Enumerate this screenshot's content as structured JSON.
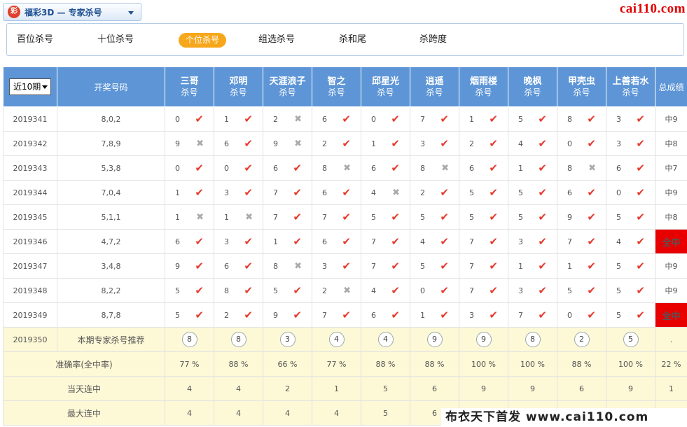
{
  "lottery_select": {
    "logo": "彩",
    "label": "福彩3D — 专家杀号"
  },
  "brand": "cai110.com",
  "tabs": [
    {
      "label": "百位杀号",
      "active": false
    },
    {
      "label": "十位杀号",
      "active": false
    },
    {
      "label": "个位杀号",
      "active": true
    },
    {
      "label": "组选杀号",
      "active": false
    },
    {
      "label": "杀和尾",
      "active": false
    },
    {
      "label": "杀跨度",
      "active": false
    }
  ],
  "table": {
    "period_select": "近10期",
    "draw_header": "开奖号码",
    "total_header": "总成绩",
    "experts": [
      {
        "name": "三哥",
        "sub": "杀号"
      },
      {
        "name": "邓明",
        "sub": "杀号"
      },
      {
        "name": "天涯浪子",
        "sub": "杀号"
      },
      {
        "name": "智之",
        "sub": "杀号"
      },
      {
        "name": "邱星光",
        "sub": "杀号"
      },
      {
        "name": "逍遥",
        "sub": "杀号"
      },
      {
        "name": "烟雨楼",
        "sub": "杀号"
      },
      {
        "name": "晚枫",
        "sub": "杀号"
      },
      {
        "name": "甲壳虫",
        "sub": "杀号"
      },
      {
        "name": "上善若水",
        "sub": "杀号"
      }
    ],
    "rows": [
      {
        "period": "2019341",
        "draw": "8,0,2",
        "kills": [
          [
            "0",
            1
          ],
          [
            "1",
            1
          ],
          [
            "2",
            0
          ],
          [
            "6",
            1
          ],
          [
            "0",
            1
          ],
          [
            "7",
            1
          ],
          [
            "1",
            1
          ],
          [
            "5",
            1
          ],
          [
            "8",
            1
          ],
          [
            "3",
            1
          ]
        ],
        "total": "中9",
        "full": false
      },
      {
        "period": "2019342",
        "draw": "7,8,9",
        "kills": [
          [
            "9",
            0
          ],
          [
            "6",
            1
          ],
          [
            "9",
            0
          ],
          [
            "2",
            1
          ],
          [
            "1",
            1
          ],
          [
            "3",
            1
          ],
          [
            "2",
            1
          ],
          [
            "4",
            1
          ],
          [
            "0",
            1
          ],
          [
            "3",
            1
          ]
        ],
        "total": "中8",
        "full": false
      },
      {
        "period": "2019343",
        "draw": "5,3,8",
        "kills": [
          [
            "0",
            1
          ],
          [
            "0",
            1
          ],
          [
            "6",
            1
          ],
          [
            "8",
            0
          ],
          [
            "6",
            1
          ],
          [
            "8",
            0
          ],
          [
            "6",
            1
          ],
          [
            "1",
            1
          ],
          [
            "8",
            0
          ],
          [
            "6",
            1
          ]
        ],
        "total": "中7",
        "full": false
      },
      {
        "period": "2019344",
        "draw": "7,0,4",
        "kills": [
          [
            "1",
            1
          ],
          [
            "3",
            1
          ],
          [
            "7",
            1
          ],
          [
            "6",
            1
          ],
          [
            "4",
            0
          ],
          [
            "2",
            1
          ],
          [
            "5",
            1
          ],
          [
            "5",
            1
          ],
          [
            "6",
            1
          ],
          [
            "0",
            1
          ]
        ],
        "total": "中9",
        "full": false
      },
      {
        "period": "2019345",
        "draw": "5,1,1",
        "kills": [
          [
            "1",
            0
          ],
          [
            "1",
            0
          ],
          [
            "7",
            1
          ],
          [
            "7",
            1
          ],
          [
            "5",
            1
          ],
          [
            "5",
            1
          ],
          [
            "5",
            1
          ],
          [
            "5",
            1
          ],
          [
            "9",
            1
          ],
          [
            "5",
            1
          ]
        ],
        "total": "中8",
        "full": false
      },
      {
        "period": "2019346",
        "draw": "4,7,2",
        "kills": [
          [
            "6",
            1
          ],
          [
            "3",
            1
          ],
          [
            "1",
            1
          ],
          [
            "6",
            1
          ],
          [
            "7",
            1
          ],
          [
            "4",
            1
          ],
          [
            "7",
            1
          ],
          [
            "3",
            1
          ],
          [
            "7",
            1
          ],
          [
            "4",
            1
          ]
        ],
        "total": "全中",
        "full": true
      },
      {
        "period": "2019347",
        "draw": "3,4,8",
        "kills": [
          [
            "9",
            1
          ],
          [
            "6",
            1
          ],
          [
            "8",
            0
          ],
          [
            "3",
            1
          ],
          [
            "7",
            1
          ],
          [
            "5",
            1
          ],
          [
            "7",
            1
          ],
          [
            "1",
            1
          ],
          [
            "1",
            1
          ],
          [
            "5",
            1
          ]
        ],
        "total": "中9",
        "full": false
      },
      {
        "period": "2019348",
        "draw": "8,2,2",
        "kills": [
          [
            "5",
            1
          ],
          [
            "8",
            1
          ],
          [
            "5",
            1
          ],
          [
            "2",
            0
          ],
          [
            "4",
            1
          ],
          [
            "0",
            1
          ],
          [
            "7",
            1
          ],
          [
            "3",
            1
          ],
          [
            "5",
            1
          ],
          [
            "5",
            1
          ]
        ],
        "total": "中9",
        "full": false
      },
      {
        "period": "2019349",
        "draw": "8,7,8",
        "kills": [
          [
            "5",
            1
          ],
          [
            "2",
            1
          ],
          [
            "9",
            1
          ],
          [
            "7",
            1
          ],
          [
            "6",
            1
          ],
          [
            "1",
            1
          ],
          [
            "3",
            1
          ],
          [
            "7",
            1
          ],
          [
            "0",
            1
          ],
          [
            "5",
            1
          ]
        ],
        "total": "全中",
        "full": true
      }
    ],
    "recommend": {
      "period": "2019350",
      "label": "本期专家杀号推荐",
      "numbers": [
        "8",
        "8",
        "3",
        "4",
        "4",
        "9",
        "9",
        "8",
        "2",
        "5"
      ],
      "total": "."
    },
    "accuracy": {
      "label": "准确率(全中率)",
      "values": [
        "77 %",
        "88 %",
        "66 %",
        "77 %",
        "88 %",
        "88 %",
        "100 %",
        "100 %",
        "88 %",
        "100 %"
      ],
      "total": "22 %"
    },
    "current_streak": {
      "label": "当天连中",
      "values": [
        "4",
        "4",
        "2",
        "1",
        "5",
        "6",
        "9",
        "9",
        "6",
        "9"
      ],
      "total": "1"
    },
    "max_streak": {
      "label": "最大连中",
      "values": [
        "4",
        "4",
        "4",
        "4",
        "5",
        "6"
      ]
    }
  },
  "icons": {
    "hit": "check-icon",
    "miss": "cross-icon"
  },
  "colors": {
    "header_blue": "#5d95d6",
    "hit_red": "#e63b2e",
    "full_hit_bg": "#e80000",
    "tab_active": "#f7a71b",
    "summary_bg": "#fdf8d6"
  },
  "watermark": "布衣天下首发 www.cai110.com"
}
